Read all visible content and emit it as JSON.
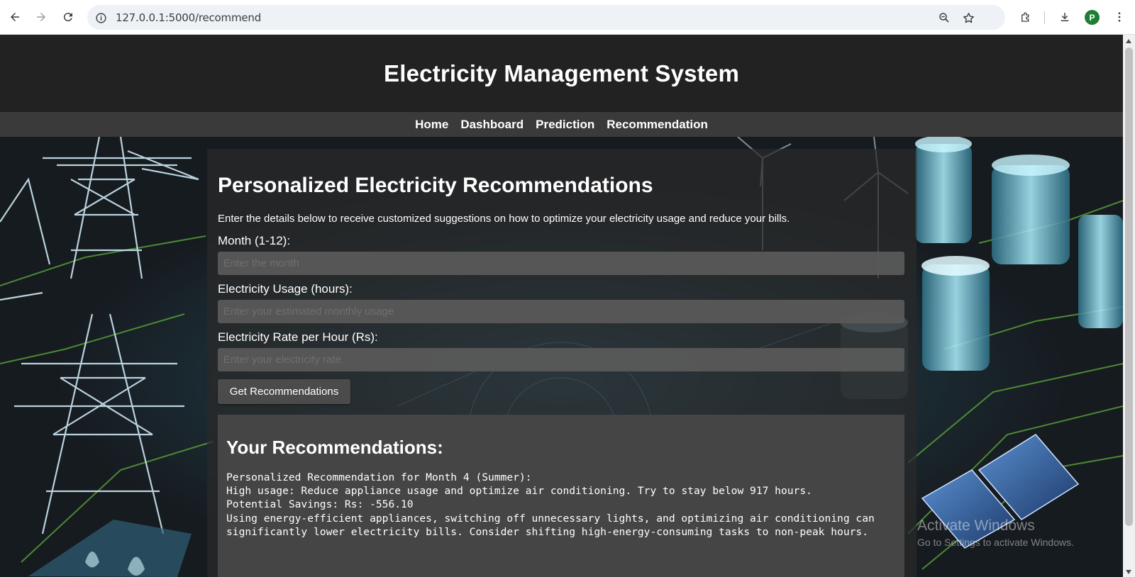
{
  "browser": {
    "url": "127.0.0.1:5000/recommend",
    "profile_initial": "P",
    "icons": [
      "back-icon",
      "forward-icon",
      "reload-icon",
      "site-info-icon",
      "zoom-icon",
      "bookmark-star-icon",
      "extensions-icon",
      "download-icon",
      "chrome-menu-icon"
    ]
  },
  "site": {
    "title": "Electricity Management System",
    "nav": [
      "Home",
      "Dashboard",
      "Prediction",
      "Recommendation"
    ]
  },
  "form": {
    "heading": "Personalized Electricity Recommendations",
    "intro": "Enter the details below to receive customized suggestions on how to optimize your electricity usage and reduce your bills.",
    "month_label": "Month (1-12):",
    "month_placeholder": "Enter the month",
    "usage_label": "Electricity Usage (hours):",
    "usage_placeholder": "Enter your estimated monthly usage",
    "rate_label": "Electricity Rate per Hour (Rs):",
    "rate_placeholder": "Enter your electricity rate",
    "submit_label": "Get Recommendations"
  },
  "results": {
    "heading": "Your Recommendations:",
    "text": "Personalized Recommendation for Month 4 (Summer):\nHigh usage: Reduce appliance usage and optimize air conditioning. Try to stay below 917 hours.\nPotential Savings: Rs: -556.10\nUsing energy-efficient appliances, switching off unnecessary lights, and optimizing air conditioning can significantly lower electricity bills. Consider shifting high-energy-consuming tasks to non-peak hours."
  },
  "watermark": {
    "line1": "Activate Windows",
    "line2": "Go to Settings to activate Windows."
  },
  "colors": {
    "header_bg": "#222222",
    "nav_bg": "#3a3a3a",
    "accent_glow": "#7fe3ff",
    "circuit_green": "#5fae3a"
  }
}
